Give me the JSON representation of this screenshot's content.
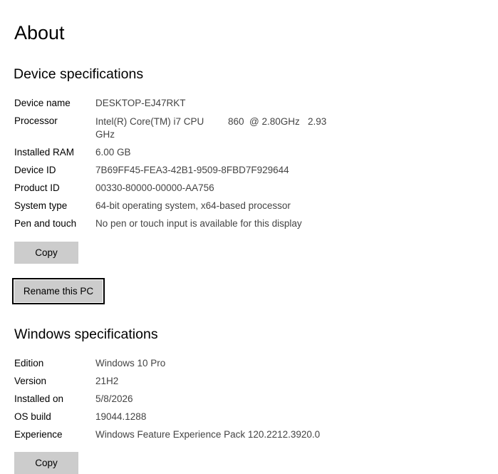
{
  "page": {
    "title": "About"
  },
  "device_specs": {
    "heading": "Device specifications",
    "rows": [
      {
        "label": "Device name",
        "value": "DESKTOP-EJ47RKT"
      },
      {
        "label": "Processor",
        "value": "Intel(R) Core(TM) i7 CPU         860  @ 2.80GHz   2.93 GHz"
      },
      {
        "label": "Installed RAM",
        "value": "6.00 GB"
      },
      {
        "label": "Device ID",
        "value": "7B69FF45-FEA3-42B1-9509-8FBD7F929644"
      },
      {
        "label": "Product ID",
        "value": "00330-80000-00000-AA756"
      },
      {
        "label": "System type",
        "value": "64-bit operating system, x64-based processor"
      },
      {
        "label": "Pen and touch",
        "value": "No pen or touch input is available for this display"
      }
    ],
    "copy_label": "Copy",
    "rename_label": "Rename this PC"
  },
  "windows_specs": {
    "heading": "Windows specifications",
    "rows": [
      {
        "label": "Edition",
        "value": "Windows 10 Pro"
      },
      {
        "label": "Version",
        "value": "21H2"
      },
      {
        "label": "Installed on",
        "value": "5/8/2026"
      },
      {
        "label": "OS build",
        "value": "19044.1288"
      },
      {
        "label": "Experience",
        "value": "Windows Feature Experience Pack 120.2212.3920.0"
      }
    ],
    "copy_label": "Copy"
  }
}
